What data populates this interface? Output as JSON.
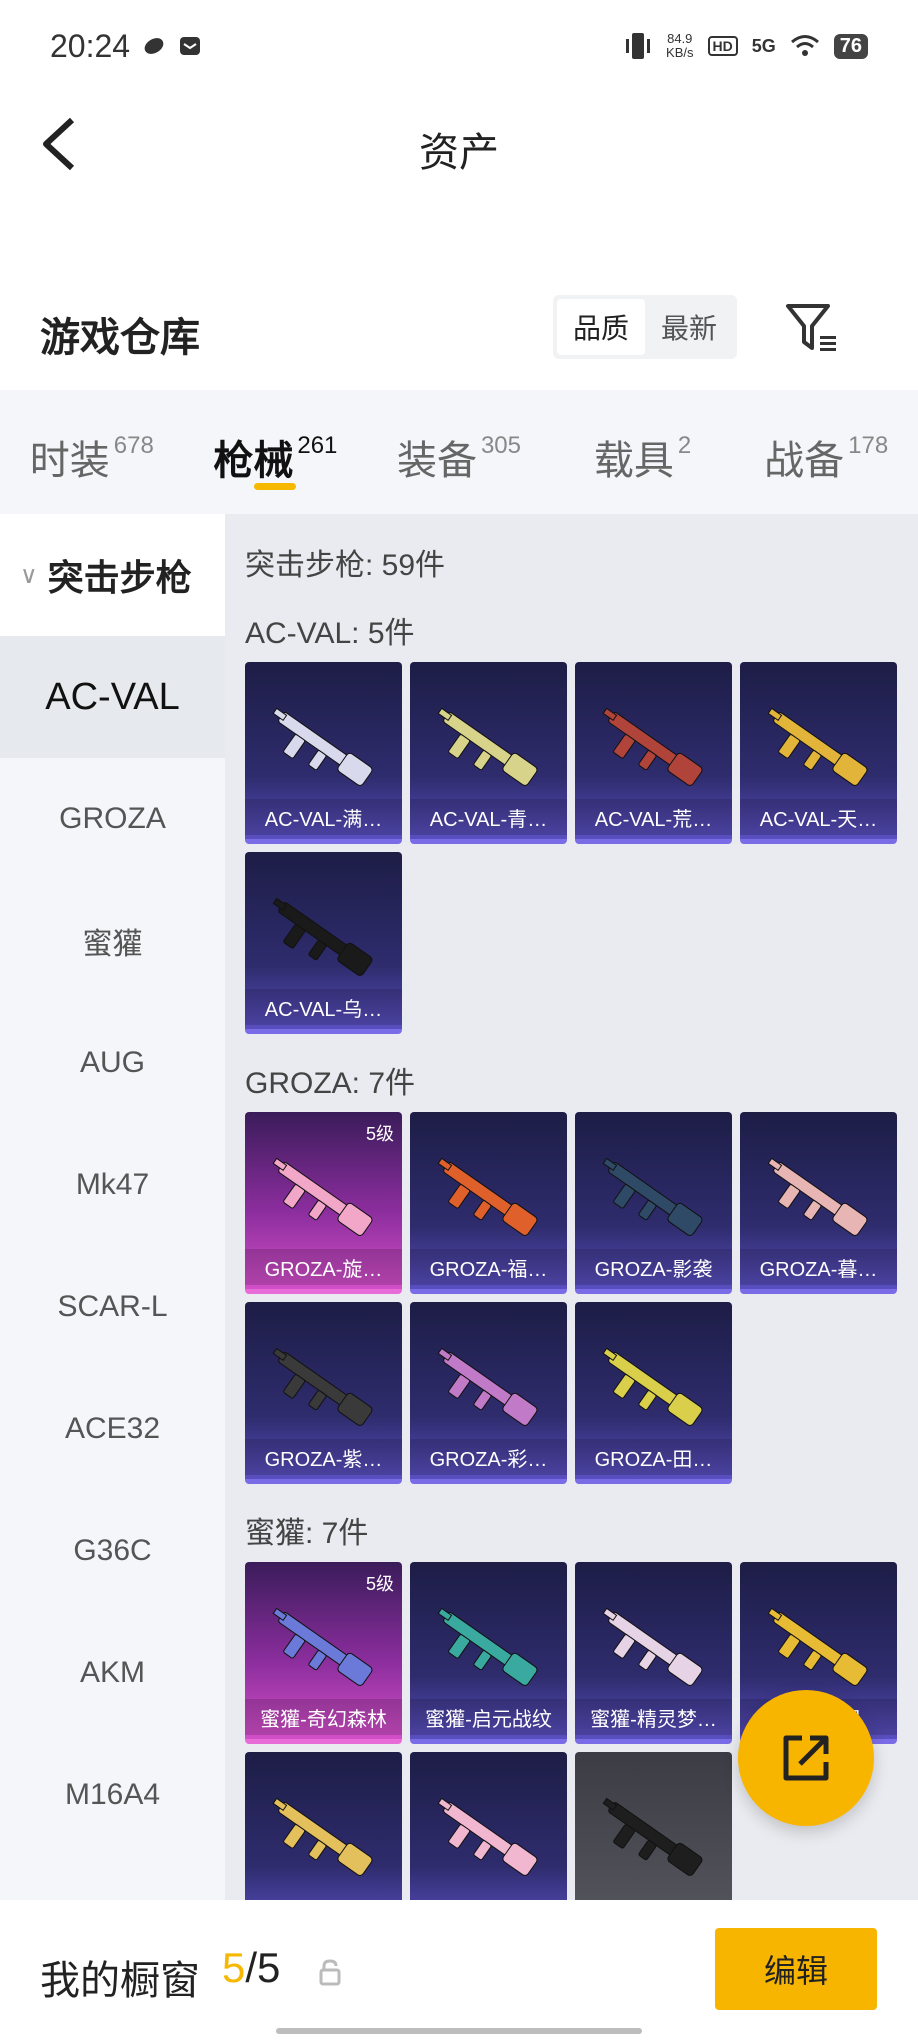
{
  "status": {
    "time": "20:24",
    "speed": "84.9",
    "speed_unit": "KB/s",
    "hd": "HD",
    "net": "5G",
    "battery": "76"
  },
  "header": {
    "title": "资产"
  },
  "warehouse": {
    "title": "游戏仓库",
    "sort_options": [
      "品质",
      "最新"
    ],
    "sort_active": "品质"
  },
  "tabs": [
    {
      "name": "时装",
      "count": "678"
    },
    {
      "name": "枪械",
      "count": "261"
    },
    {
      "name": "装备",
      "count": "305"
    },
    {
      "name": "载具",
      "count": "2"
    },
    {
      "name": "战备",
      "count": "178"
    }
  ],
  "active_tab": "枪械",
  "sidebar": {
    "category": "突击步枪",
    "items": [
      "AC-VAL",
      "GROZA",
      "蜜獾",
      "AUG",
      "Mk47",
      "SCAR-L",
      "ACE32",
      "G36C",
      "AKM",
      "M16A4"
    ],
    "active": "AC-VAL"
  },
  "content": {
    "total": "突击步枪: 59件",
    "groups": [
      {
        "title": "AC-VAL: 5件",
        "items": [
          {
            "name": "AC-VAL-满…",
            "style": "blue",
            "gun_color": "#d9d9ee"
          },
          {
            "name": "AC-VAL-青…",
            "style": "blue",
            "gun_color": "#d7d38a"
          },
          {
            "name": "AC-VAL-荒…",
            "style": "blue",
            "gun_color": "#b0443a"
          },
          {
            "name": "AC-VAL-天…",
            "style": "blue",
            "gun_color": "#e2b43a"
          },
          {
            "name": "AC-VAL-乌…",
            "style": "blue",
            "gun_color": "#1a1a1a"
          }
        ]
      },
      {
        "title": "GROZA: 7件",
        "items": [
          {
            "name": "GROZA-旋…",
            "style": "pink",
            "level": "5级",
            "gun_color": "#f2a7c9"
          },
          {
            "name": "GROZA-福…",
            "style": "blue",
            "gun_color": "#e0602c"
          },
          {
            "name": "GROZA-影袭",
            "style": "blue",
            "gun_color": "#2f4a66"
          },
          {
            "name": "GROZA-暮…",
            "style": "blue",
            "gun_color": "#e8b5b5"
          },
          {
            "name": "GROZA-紫…",
            "style": "blue",
            "gun_color": "#3a3a3a"
          },
          {
            "name": "GROZA-彩…",
            "style": "blue",
            "gun_color": "#c07ac8"
          },
          {
            "name": "GROZA-田…",
            "style": "blue",
            "gun_color": "#d9cf4a"
          }
        ]
      },
      {
        "title": "蜜獾: 7件",
        "items": [
          {
            "name": "蜜獾-奇幻森林",
            "style": "pink",
            "level": "5级",
            "gun_color": "#6b7ad8"
          },
          {
            "name": "蜜獾-启元战纹",
            "style": "blue",
            "gun_color": "#3aa9a0"
          },
          {
            "name": "蜜獾-精灵梦…",
            "style": "blue",
            "gun_color": "#e7d3e6"
          },
          {
            "name": "蜜獾-…机",
            "style": "blue",
            "gun_color": "#e8bb35"
          },
          {
            "name": "",
            "style": "blue",
            "gun_color": "#e4c05c"
          },
          {
            "name": "",
            "style": "blue",
            "gun_color": "#f2b7d0"
          },
          {
            "name": "",
            "style": "grey",
            "gun_color": "#1e1e1e"
          }
        ]
      }
    ]
  },
  "bottom": {
    "label": "我的橱窗",
    "current": "5",
    "sep_total": "/5",
    "edit": "编辑"
  },
  "colors": {
    "accent": "#f8b500",
    "card_blue": "#2f2c6e",
    "card_pink": "#8a2d9c"
  }
}
